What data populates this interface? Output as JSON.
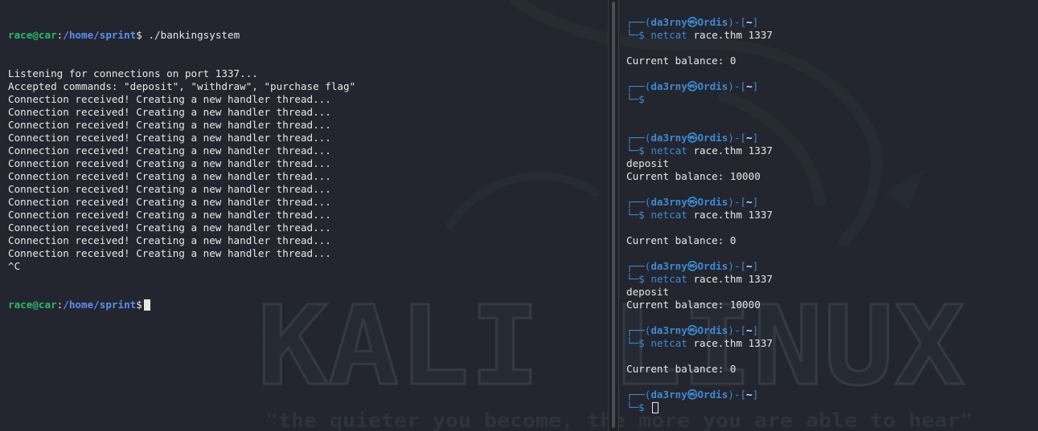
{
  "left_terminal": {
    "prompt_user_host": "race@car",
    "prompt_sep": ":",
    "prompt_path": "/home/sprint",
    "prompt_symbol": "$",
    "command": " ./bankingsystem",
    "output": [
      "Listening for connections on port 1337...",
      "Accepted commands: \"deposit\", \"withdraw\", \"purchase flag\"",
      "Connection received! Creating a new handler thread...",
      "Connection received! Creating a new handler thread...",
      "Connection received! Creating a new handler thread...",
      "Connection received! Creating a new handler thread...",
      "Connection received! Creating a new handler thread...",
      "Connection received! Creating a new handler thread...",
      "Connection received! Creating a new handler thread...",
      "Connection received! Creating a new handler thread...",
      "Connection received! Creating a new handler thread...",
      "Connection received! Creating a new handler thread...",
      "Connection received! Creating a new handler thread...",
      "Connection received! Creating a new handler thread...",
      "Connection received! Creating a new handler thread...",
      "^C"
    ]
  },
  "right_terminal": {
    "prompt_open": "┌──(",
    "prompt_user": "da3rny",
    "prompt_at": "㉿",
    "prompt_host": "Ordis",
    "prompt_mid": ")-[",
    "prompt_dir": "~",
    "prompt_close": "]",
    "prompt_line2": "└─",
    "prompt_symbol": "$",
    "net_cmd": "netcat",
    "net_args": " race.thm 1337",
    "blank": "",
    "sessions": [
      {
        "command": true,
        "lines": [
          "",
          "Current balance: 0"
        ]
      },
      {
        "command": false,
        "lines": [
          ""
        ]
      },
      {
        "command": true,
        "lines": [
          "deposit",
          "Current balance: 10000"
        ]
      },
      {
        "command": true,
        "lines": [
          "",
          "Current balance: 0"
        ]
      },
      {
        "command": true,
        "lines": [
          "deposit",
          "Current balance: 10000"
        ]
      },
      {
        "command": true,
        "lines": [
          "",
          "Current balance: 0"
        ]
      }
    ]
  },
  "wallpaper": {
    "title": "KALI LINUX",
    "tagline": "\"the quieter you become, the more you are able to hear\""
  },
  "colors": {
    "background": "#23262e",
    "prompt_user": "#29b86e",
    "prompt_path": "#5c8df7",
    "kali_blue": "#3c8ad6",
    "text": "#e8e8e8"
  }
}
